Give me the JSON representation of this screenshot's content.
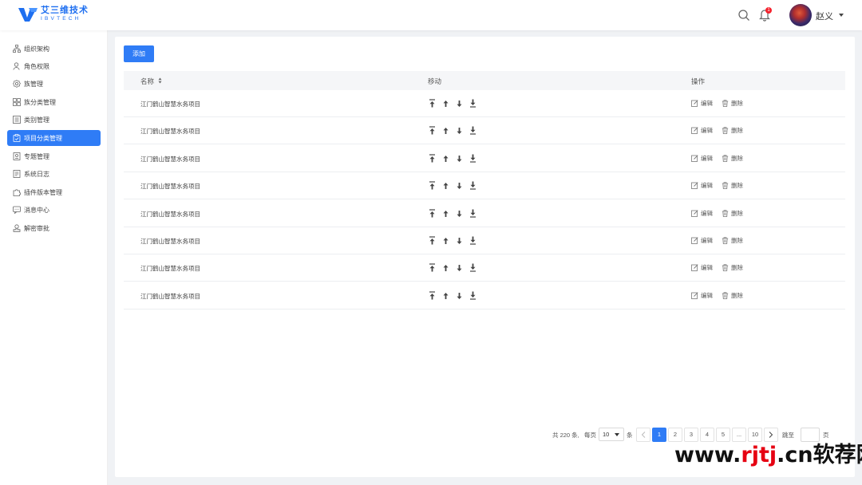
{
  "brand": {
    "name_cn": "艾三维技术",
    "name_en": "IBVTECH",
    "color": "#1e6ff0"
  },
  "header": {
    "search_icon": "search-icon",
    "bell_icon": "bell-icon",
    "notification_count": "1",
    "user_name": "赵义"
  },
  "sidebar": {
    "items": [
      {
        "label": "组织架构",
        "icon": "org-structure-icon",
        "active": false
      },
      {
        "label": "角色权限",
        "icon": "user-role-icon",
        "active": false
      },
      {
        "label": "族管理",
        "icon": "gear-icon",
        "active": false
      },
      {
        "label": "族分类管理",
        "icon": "grid-icon",
        "active": false
      },
      {
        "label": "类别管理",
        "icon": "list-icon",
        "active": false
      },
      {
        "label": "项目分类管理",
        "icon": "clipboard-icon",
        "active": true
      },
      {
        "label": "专题管理",
        "icon": "topic-icon",
        "active": false
      },
      {
        "label": "系统日志",
        "icon": "log-icon",
        "active": false
      },
      {
        "label": "插件版本管理",
        "icon": "plugin-icon",
        "active": false
      },
      {
        "label": "消息中心",
        "icon": "message-icon",
        "active": false
      },
      {
        "label": "解密审批",
        "icon": "stamp-icon",
        "active": false
      }
    ]
  },
  "toolbar": {
    "add_label": "添加"
  },
  "table": {
    "columns": {
      "name": "名称",
      "move": "移动",
      "ops": "操作"
    },
    "rows": [
      {
        "name": "江门鹤山智慧水务项目"
      },
      {
        "name": "江门鹤山智慧水务项目"
      },
      {
        "name": "江门鹤山智慧水务项目"
      },
      {
        "name": "江门鹤山智慧水务项目"
      },
      {
        "name": "江门鹤山智慧水务项目"
      },
      {
        "name": "江门鹤山智慧水务项目"
      },
      {
        "name": "江门鹤山智慧水务项目"
      },
      {
        "name": "江门鹤山智慧水务项目"
      }
    ],
    "edit_label": "编辑",
    "delete_label": "删除"
  },
  "pagination": {
    "total_text": "共 220 条,",
    "per_page_label": "每页",
    "page_size": "10",
    "unit": "条",
    "pages": [
      "1",
      "2",
      "3",
      "4",
      "5",
      "...",
      "10"
    ],
    "current": "1",
    "jump_label": "跳至",
    "jump_unit": "页"
  },
  "watermark": {
    "prefix": "www.",
    "red": "rjtj",
    "mid": ".cn",
    "suffix": "软荐网"
  },
  "colors": {
    "primary": "#2f7cf6",
    "badge": "#f5222d"
  }
}
